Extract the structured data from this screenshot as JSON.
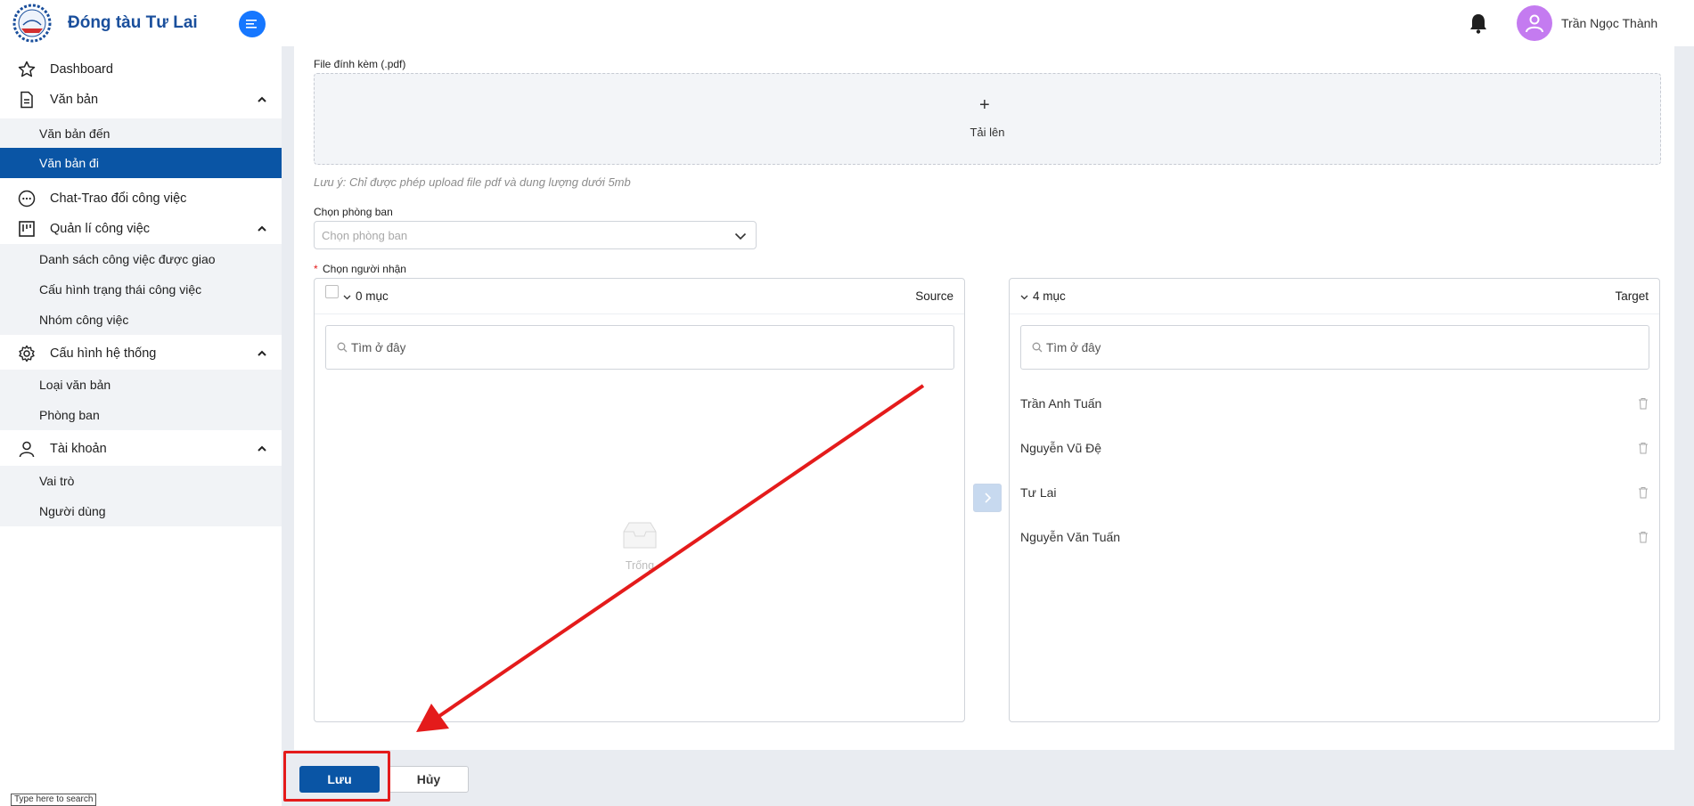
{
  "app": {
    "brand": "Đóng tàu Tư Lai",
    "user": "Trần Ngọc Thành"
  },
  "sidebar": {
    "dashboard": "Dashboard",
    "van_ban": "Văn bản",
    "van_ban_den": "Văn bản đến",
    "van_ban_di": "Văn bản đi",
    "chat": "Chat-Trao đổi công việc",
    "quan_li": "Quản lí công việc",
    "ds_cv": "Danh sách công việc được giao",
    "cau_hinh_tt": "Cấu hình trạng thái công việc",
    "nhom_cv": "Nhóm công việc",
    "cau_hinh_ht": "Cấu hình hệ thống",
    "loai_vb": "Loại văn bản",
    "phong_ban": "Phòng ban",
    "tai_khoan": "Tài khoản",
    "vai_tro": "Vai trò",
    "nguoi_dung": "Người dùng"
  },
  "form": {
    "file_label": "File đính kèm (.pdf)",
    "upload_text": "Tải lên",
    "note": "Lưu ý: Chỉ được phép upload file pdf và dung lượng dưới 5mb",
    "dept_label": "Chọn phòng ban",
    "dept_placeholder": "Chọn phòng ban",
    "recipient_required": "*",
    "recipient_label": "Chọn người nhận"
  },
  "transfer": {
    "source": {
      "count": "0 mục",
      "title": "Source",
      "search_placeholder": "Tìm ở đây",
      "empty": "Trống"
    },
    "target": {
      "count": "4 mục",
      "title": "Target",
      "search_placeholder": "Tìm ở đây",
      "items": [
        "Trần Anh Tuấn",
        "Nguyễn Vũ Đệ",
        "Tư Lai",
        "Nguyễn Văn Tuấn"
      ]
    }
  },
  "actions": {
    "save": "Lưu",
    "cancel": "Hủy"
  },
  "taskbar": {
    "search_hint": "Type here to search"
  },
  "colors": {
    "primary": "#0a55a5",
    "accent": "#1677ff",
    "annotation": "#e41b1b"
  }
}
